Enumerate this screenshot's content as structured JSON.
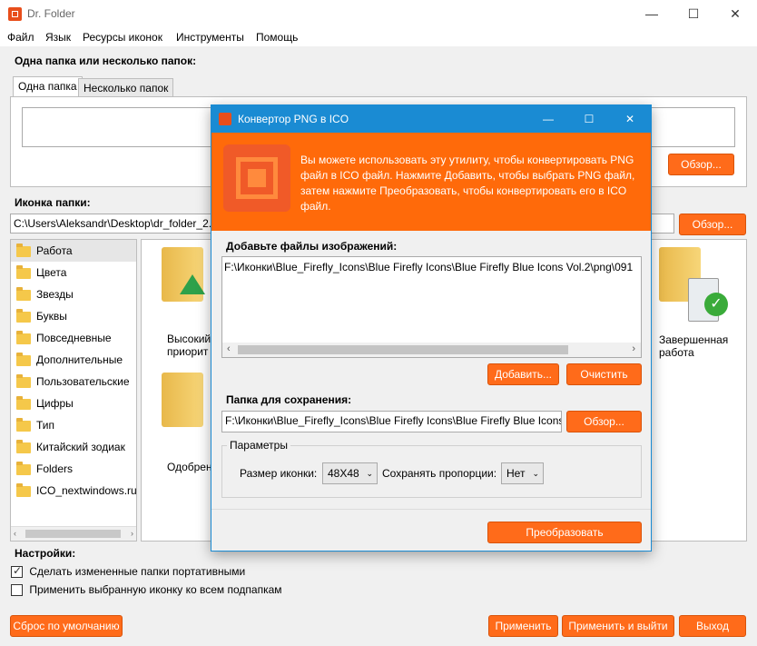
{
  "window": {
    "title": "Dr. Folder",
    "minimize": "—",
    "maximize": "☐",
    "close": "✕"
  },
  "menu": [
    "Файл",
    "Язык",
    "Ресурсы иконок",
    "Инструменты",
    "Помощь"
  ],
  "folders_section": {
    "label": "Одна папка или несколько папок:",
    "tabs": [
      "Одна папка",
      "Несколько папок"
    ],
    "browse": "Обзор..."
  },
  "icon_section": {
    "label": "Иконка папки:",
    "path": "C:\\Users\\Aleksandr\\Desktop\\dr_folder_2.6.",
    "browse": "Обзор..."
  },
  "categories": [
    "Работа",
    "Цвета",
    "Звезды",
    "Буквы",
    "Повседневные",
    "Дополнительные",
    "Пользовательские",
    "Цифры",
    "Тип",
    "Китайский зодиак",
    "Folders",
    "ICO_nextwindows.ru"
  ],
  "icons": {
    "item1": "Высокий приорит",
    "item2": "Одобрен",
    "item3": "Завершенная работа"
  },
  "settings": {
    "label": "Настройки:",
    "option1": "Сделать измененные папки портативными",
    "option1_checked": true,
    "option2": "Применить выбранную иконку ко всем подпапкам",
    "option2_checked": false
  },
  "bottom_buttons": {
    "reset": "Сброс по умолчанию",
    "apply": "Применить",
    "apply_exit": "Применить и выйти",
    "exit": "Выход"
  },
  "dialog": {
    "title": "Конвертор PNG в ICO",
    "minimize": "—",
    "maximize": "☐",
    "close": "✕",
    "banner_text": "Вы можете использовать эту утилиту, чтобы конвертировать PNG файл в ICO файл. Нажмите Добавить, чтобы выбрать PNG файл, затем нажмите Преобразовать, чтобы конвертировать его в ICO файл.",
    "add_label": "Добавьте файлы изображений:",
    "file_entry": "F:\\Иконки\\Blue_Firefly_Icons\\Blue Firefly Icons\\Blue Firefly Blue Icons Vol.2\\png\\091",
    "add_button": "Добавить...",
    "clear_button": "Очистить",
    "save_label": "Папка для сохранения:",
    "save_path": "F:\\Иконки\\Blue_Firefly_Icons\\Blue Firefly Icons\\Blue Firefly Blue Icons",
    "browse_button": "Обзор...",
    "params_label": "Параметры",
    "icon_size_label": "Размер иконки:",
    "icon_size_value": "48X48",
    "keep_ratio_label": "Сохранять пропорции:",
    "keep_ratio_value": "Нет",
    "convert_button": "Преобразовать"
  },
  "colors": {
    "accent": "#ff6b1a",
    "dialog_title": "#1a8bd3",
    "banner": "#ff6a0a"
  }
}
